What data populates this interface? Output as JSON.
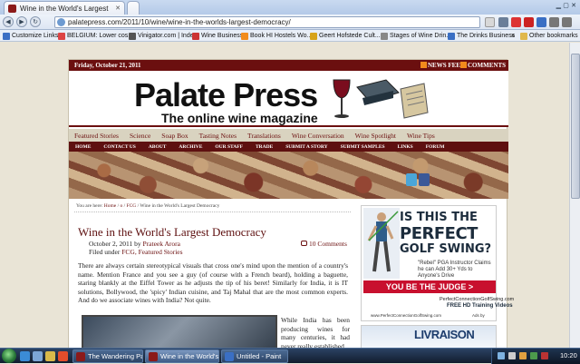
{
  "browser": {
    "tab_title": "Wine in the World's Largest",
    "url": "palatepress.com/2011/10/wine/wine-in-the-worlds-largest-democracy/",
    "nav": {
      "back_label": "◀",
      "forward_label": "▶",
      "reload_label": "↻"
    }
  },
  "bookmarks": {
    "items": [
      {
        "label": "Customize Links"
      },
      {
        "label": "BELGIUM: Lower cos..."
      },
      {
        "label": "Vinigator.com | Inde..."
      },
      {
        "label": "Wine Business"
      },
      {
        "label": "Book HI Hostels Wo..."
      },
      {
        "label": "Geert Hofstede Cult..."
      },
      {
        "label": "Stages of Wine Drin..."
      },
      {
        "label": "The Drinks Business"
      }
    ],
    "chevron": "»",
    "other_label": "Other bookmarks"
  },
  "site": {
    "date": "Friday, October 21, 2011",
    "news_feed": "NEWS FEED",
    "comments_feed": "COMMENTS",
    "title": "Palate Press",
    "subtitle": "The online wine magazine",
    "categories": [
      "Featured Stories",
      "Science",
      "Soap Box",
      "Tasting Notes",
      "Translations",
      "Wine Conversation",
      "Wine Spotlight",
      "Wine Tips"
    ],
    "main_nav": [
      "HOME",
      "CONTACT US",
      "ABOUT",
      "ARCHIVE",
      "OUR STAFF",
      "TRADE",
      "SUBMIT A STORY",
      "SUBMIT SAMPLES",
      "LINKS",
      "FORUM"
    ]
  },
  "article": {
    "breadcrumb_prefix": "You are here:",
    "breadcrumb_home": "Home",
    "breadcrumb_sep1": " / ",
    "breadcrumb_o": "o",
    "breadcrumb_sep2": " / ",
    "breadcrumb_fcg": "FCG",
    "breadcrumb_tail": " / Wine in the World's Largest Democracy",
    "title": "Wine in the World's Largest Democracy",
    "date": "October 2, 2011 by ",
    "author": "Prateek Arora",
    "filed_prefix": "Filed under ",
    "filed_links": "FCG, Featured Stories",
    "comments": "10 Comments",
    "intro": "There are always certain stereotypical visuals that cross one's mind upon the mention of a country's name. Mention France and you see a guy (of course with a French beard), holding a baguette, staring blankly at the Eiffel Tower as he adjusts the tip of his beret! Similarly for India, it is IT solutions, Bollywood, the 'spicy' Indian cuisine, and Taj Mahal that are the most common experts. And do we associate wines with India? Not quite.",
    "para2": "While India has been producing wines for many centuries, it had never really established"
  },
  "ad": {
    "line1": "IS THIS THE",
    "line2": "PERFECT",
    "line3": "GOLF SWING?",
    "body": "\"Rebel\" PGA Instructor Claims he can Add 30+ Yds to Anyone's Drive",
    "button": "YOU BE THE JUDGE >",
    "foot1": "PerfectConnectionGolfSwing.com",
    "foot2": "FREE HD Training Videos",
    "foot3": "www.PerfectConnectionGolfSwing.com",
    "byline": "Ads by",
    "next": "LIVRAISON"
  },
  "taskbar": {
    "tasks": [
      {
        "label": "The Wandering Pala..."
      },
      {
        "label": "Wine in the World's ..."
      },
      {
        "label": "Untitled - Paint"
      }
    ],
    "clock": "10:20"
  },
  "colors": {
    "brand": "#6b0f0f",
    "accent_red": "#c8102e",
    "ad_navy": "#1c2c3c"
  }
}
